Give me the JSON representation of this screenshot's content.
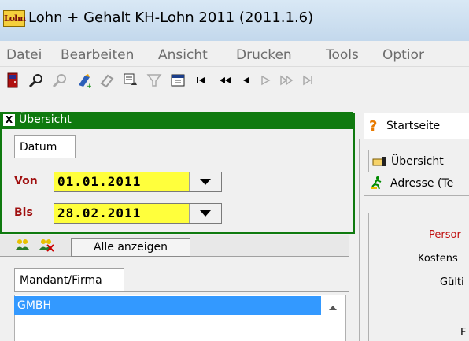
{
  "window": {
    "title": "Lohn + Gehalt KH-Lohn 2011 (2011.1.6)",
    "logo_text": "Lohn"
  },
  "menu": [
    "Datei",
    "Bearbeiten",
    "Ansicht",
    "Drucken",
    "Tools",
    "Optior"
  ],
  "toolbar": {
    "icons": [
      "exit-door-icon",
      "search-icon",
      "search-disabled-icon",
      "magic-wand-icon",
      "eraser-icon",
      "print-preview-icon",
      "filter-icon",
      "calendar-icon",
      "first-record-icon",
      "previous-page-icon",
      "previous-record-icon",
      "next-record-icon",
      "next-page-icon",
      "last-record-icon"
    ]
  },
  "overview": {
    "title": "Übersicht",
    "close_glyph": "X",
    "tab_datum": "Datum",
    "von_label": "Von",
    "von_value": "01.01.2011",
    "bis_label": "Bis",
    "bis_value": "28.02.2011"
  },
  "lower": {
    "show_all_label": "Alle anzeigen",
    "tab_mandant": "Mandant/Firma",
    "list": [
      "GMBH"
    ]
  },
  "right": {
    "tab_start": "Startseite",
    "tab_ueber": "Übersicht",
    "address_label": "Adresse (Te",
    "form_labels": [
      "Persor",
      "Kostens",
      "Gülti",
      "F"
    ]
  },
  "colors": {
    "panel_green": "#0f7a0f",
    "date_yellow": "#ffff3c",
    "selection_blue": "#3399ff",
    "label_red": "#a01010"
  }
}
